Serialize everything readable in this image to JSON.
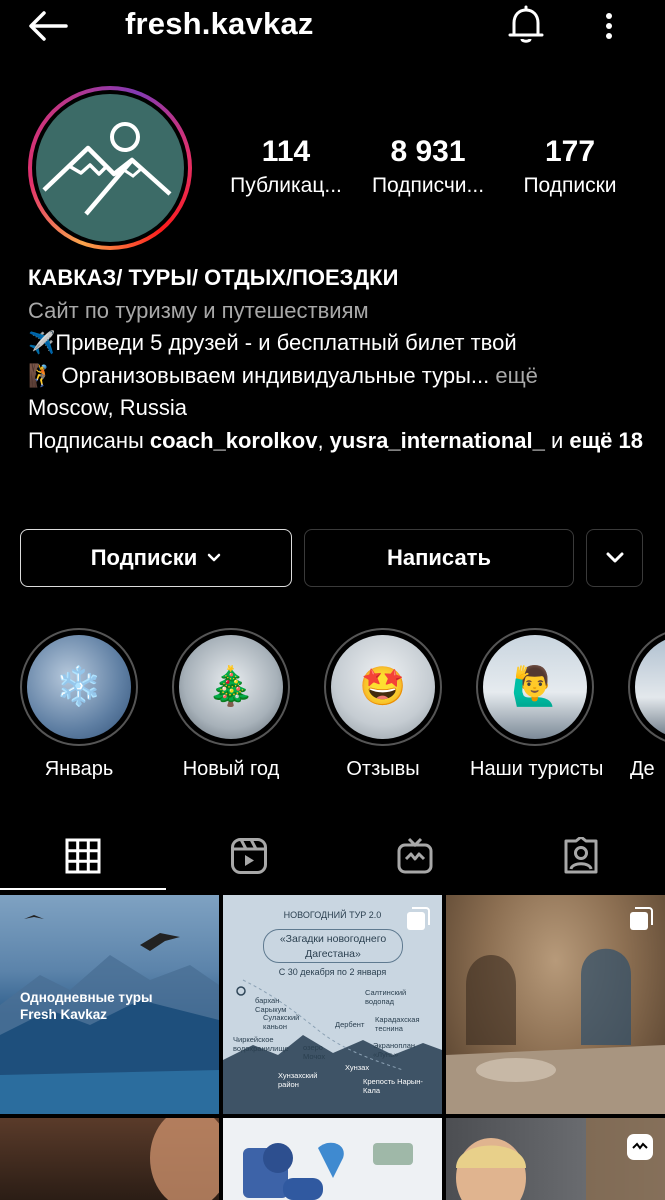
{
  "header": {
    "username": "fresh.kavkaz"
  },
  "stats": [
    {
      "value": "114",
      "label": "Публикац..."
    },
    {
      "value": "8 931",
      "label": "Подписчи..."
    },
    {
      "value": "177",
      "label": "Подписки"
    }
  ],
  "bio": {
    "title": "КАВКАЗ/ ТУРЫ/ ОТДЫХ/ПОЕЗДКИ",
    "category": "Сайт по туризму и путешествиям",
    "line1": "✈️Приведи 5 друзей - и бесплатный билет твой",
    "line2": "🧗 Организовываем индивидуальные туры...",
    "more": " ещё",
    "location": "Moscow, Russia",
    "followed_prefix": "Подписаны ",
    "followed_user1": "coach_korolkov",
    "followed_sep": ", ",
    "followed_user2": "yusra_international_",
    "followed_and": " и ",
    "followed_more": "ещё 18"
  },
  "buttons": {
    "following": "Подписки",
    "message": "Написать"
  },
  "highlights": [
    {
      "label": "Январь",
      "emoji": "❄️"
    },
    {
      "label": "Новый год",
      "emoji": "🎄"
    },
    {
      "label": "Отзывы",
      "emoji": "🤩"
    },
    {
      "label": "Наши туристы",
      "emoji": "🙋‍♂️"
    },
    {
      "label": "Де",
      "emoji": ""
    }
  ],
  "posts": {
    "post1_caption_line1": "Однодневные туры",
    "post1_caption_line2": "Fresh Kavkaz",
    "post2": {
      "heading": "НОВОГОДНИЙ ТУР 2.0",
      "title_line1": "«Загадки новогоднего",
      "title_line2": "Дагестана»",
      "dates": "С 30 декабря по 2 января",
      "labels": [
        "бархан Сарыкум",
        "Сулакский каньон",
        "Чиркейское водохранилище",
        "Салтинский водопад",
        "Дербент",
        "Карадахская теснина",
        "Экраноплан «Лунь»",
        "озеро Мочох",
        "Хунзахский район",
        "Хунзах",
        "Крепость Нарын-Кала"
      ]
    }
  },
  "colors": {
    "background": "#000000",
    "secondary_text": "#a8a8a8",
    "avatar_bg": "#3c6b67",
    "button_border": "#3a3a3a"
  }
}
